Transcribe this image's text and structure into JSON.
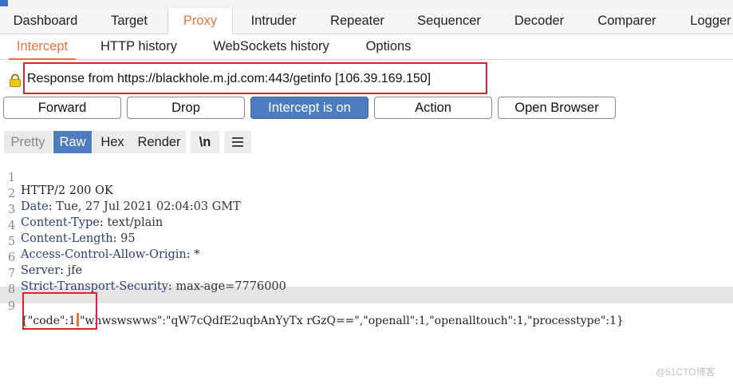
{
  "main_tabs": [
    {
      "label": "Dashboard"
    },
    {
      "label": "Target"
    },
    {
      "label": "Proxy",
      "active": true
    },
    {
      "label": "Intruder"
    },
    {
      "label": "Repeater"
    },
    {
      "label": "Sequencer"
    },
    {
      "label": "Decoder"
    },
    {
      "label": "Comparer"
    },
    {
      "label": "Logger"
    }
  ],
  "sub_tabs": [
    {
      "label": "Intercept",
      "active": true
    },
    {
      "label": "HTTP history"
    },
    {
      "label": "WebSockets history"
    },
    {
      "label": "Options"
    }
  ],
  "intercept": {
    "info_text": "Response from https://blackhole.m.jd.com:443/getinfo  [106.39.169.150]",
    "lock_icon": "lock-icon"
  },
  "buttons": {
    "forward": "Forward",
    "drop": "Drop",
    "intercept_toggle": "Intercept is on",
    "action": "Action",
    "open_browser": "Open Browser"
  },
  "view_tabs": {
    "pretty": "Pretty",
    "raw": "Raw",
    "hex": "Hex",
    "render": "Render",
    "newline": "\\n",
    "menu_icon": "hamburger-icon"
  },
  "response_lines": [
    {
      "num": "1",
      "text": "HTTP/2 200 OK"
    },
    {
      "num": "2",
      "key": "Date",
      "value": " Tue, 27 Jul 2021 02:04:03 GMT"
    },
    {
      "num": "3",
      "key": "Content-Type",
      "value": " text/plain"
    },
    {
      "num": "4",
      "key": "Content-Length",
      "value": " 95"
    },
    {
      "num": "5",
      "key": "Access-Control-Allow-Origin",
      "value": " *"
    },
    {
      "num": "6",
      "key": "Server",
      "value": " jfe"
    },
    {
      "num": "7",
      "key": "Strict-Transport-Security",
      "value": " max-age=7776000"
    },
    {
      "num": "8",
      "text": ""
    },
    {
      "num": "9",
      "body_before_caret": "{\"code\":1",
      "body_after_caret": "\"whwswswws\":\"qW7cQdfE2uqbAnYyTx rGzQ==\",\"openall\":1,\"openalltouch\":1,\"processtype\":1}"
    }
  ],
  "watermark": "@51CTO博客",
  "colors": {
    "active_tab": "#e8763c",
    "intercept_on": "#4d7cc1",
    "highlight_box": "#e0222a"
  }
}
